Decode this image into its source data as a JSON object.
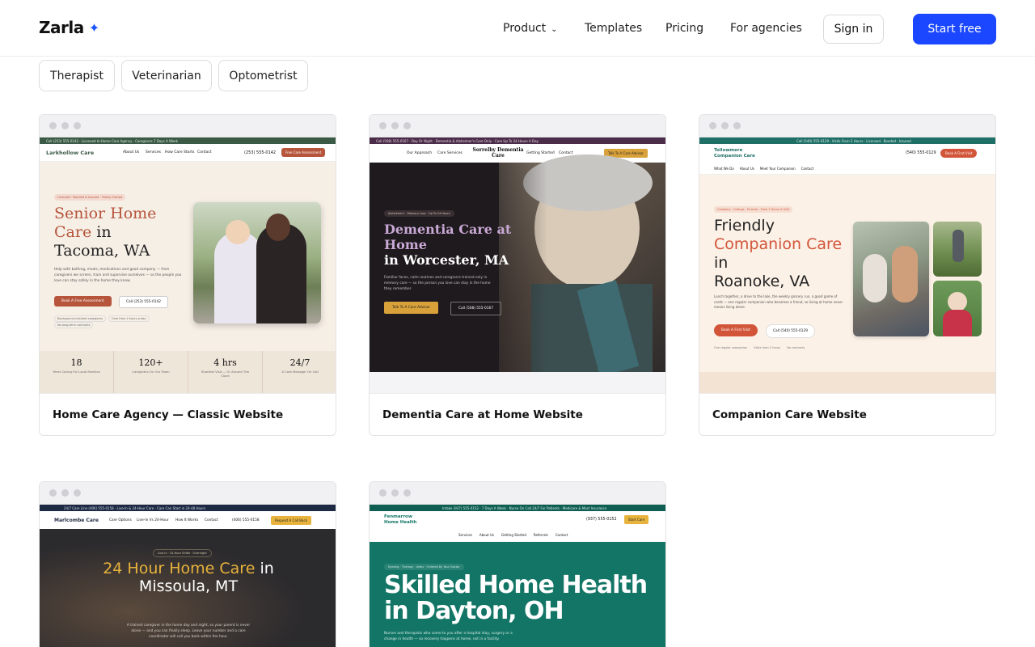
{
  "header": {
    "logo_text": "Zarla",
    "logo_mark": "✦",
    "nav": {
      "product": "Product",
      "templates": "Templates",
      "pricing": "Pricing",
      "agencies": "For agencies"
    },
    "sign_in": "Sign in",
    "start_free": "Start free"
  },
  "filters": [
    "Therapist",
    "Veterinarian",
    "Optometrist"
  ],
  "cards": [
    {
      "title": "Home Care Agency — Classic Website",
      "site": {
        "topbar": "Call (253) 555-0142 · Licensed In-Home Care Agency · Caregivers 7 Days A Week",
        "brand": "Larkhollow Care",
        "menu": [
          "About Us",
          "Services",
          "How Care Starts",
          "Contact"
        ],
        "phone": "(253) 555-0142",
        "cta": "Free Care Assessment",
        "pill": "Licensed · Bonded & Insured · Family-Owned",
        "headline_accent": "Senior Home Care",
        "headline_rest1": "in",
        "headline_rest2": "Tacoma, WA",
        "body": "Help with bathing, meals, medications and good company — from caregivers we screen, train and supervise ourselves — so the people you love can stay safely in the home they know.",
        "btn1": "Book A Free Assessment",
        "btn2": "Call (253) 555-0142",
        "tags": [
          "Background-checked caregivers",
          "Care from 4 hours a day",
          "No long-term contracts"
        ],
        "stats": [
          {
            "value": "18",
            "label": "Years Caring For Local Families"
          },
          {
            "value": "120+",
            "label": "Caregivers On Our Team"
          },
          {
            "value": "4 hrs",
            "label": "Shortest Visit — Or Around The Clock"
          },
          {
            "value": "24/7",
            "label": "A Care Manager On Call"
          }
        ]
      }
    },
    {
      "title": "Dementia Care at Home Website",
      "site": {
        "topbar": "Call (508) 555-0167 · Day Or Night · Dementia & Alzheimer's Care Only · Care Up To 24 Hours A Day",
        "menu_left": [
          "Our Approach",
          "Care Services"
        ],
        "brand": "Sorrelby Dementia Care",
        "menu_right": [
          "Getting Started",
          "Contact"
        ],
        "cta": "Talk To A Care Advisor",
        "pill": "Alzheimer's · Memory Loss · Up To 24 Hours",
        "headline_accent": "Dementia Care at Home",
        "headline_rest": "in Worcester, MA",
        "body": "Familiar faces, calm routines and caregivers trained only in memory care — so the person you love can stay in the home they remember.",
        "btn1": "Talk To A Care Advisor",
        "btn2": "Call (508) 555-0167"
      }
    },
    {
      "title": "Companion Care Website",
      "site": {
        "topbar": "Call (540) 555-0129 · Visits From 2 Hours · Licensed · Bonded · Insured",
        "brand": "Tollowmere Companion Care",
        "phone": "(540) 555-0129",
        "cta": "Book A First Visit",
        "menu": [
          "What We Do",
          "About Us",
          "Meet Your Companion",
          "Contact"
        ],
        "pill": "Company · Outings · Errands · From 2 Hours A Visit",
        "headline1": "Friendly",
        "headline_accent": "Companion Care",
        "headline_rest1": "in",
        "headline_rest2": "Roanoke, VA",
        "body": "Lunch together, a drive to the lake, the weekly grocery run, a good game of cards — one regular companion who becomes a friend, so living at home never means living alone.",
        "btn1": "Book A First Visit",
        "btn2": "Call (540) 555-0129",
        "tags": [
          "One regular companion",
          "Visits from 2 hours",
          "No contracts"
        ]
      }
    },
    {
      "title": "",
      "site": {
        "topbar": "24/7 Care Line (406) 555-0158 · Live-In & 24-Hour Care · Care Can Start in 24-48 Hours",
        "brand": "Marlcombe Care",
        "menu": [
          "Care Options",
          "Live-In Vs 24-Hour",
          "How It Works",
          "Contact"
        ],
        "phone": "(406) 555-0158",
        "cta": "Request A Call Back",
        "pill": "Live-In · 24-Hour Shifts · Overnight",
        "headline_accent": "24 Hour Home Care",
        "headline_rest1": "in",
        "headline_rest2": "Missoula, MT",
        "body": "A trained caregiver in the home day and night, so your parent is never alone — and you can finally sleep. Leave your number and a care coordinator will call you back within the hour."
      }
    },
    {
      "title": "",
      "site": {
        "topbar": "Intake (937) 555-0152 · 7 Days A Week · Nurse On Call 24/7 For Patients · Medicare & Most Insurance",
        "brand": "Fenmarrow Home Health",
        "phone": "(937) 555-0152",
        "cta": "Start Care",
        "menu": [
          "Services",
          "About Us",
          "Getting Started",
          "Referrals",
          "Contact"
        ],
        "pill": "Nursing · Therapy · Aides · Ordered By Your Doctor",
        "headline1": "Skilled Home Health",
        "headline2": "in Dayton, OH",
        "body": "Nurses and therapists who come to you after a hospital stay, surgery or a change in health — so recovery happens at home, not in a facility."
      }
    }
  ],
  "colors": {
    "accent": "#1a47ff",
    "card1_accent": "#b6553c",
    "card2_bg": "#1f1a1d",
    "card2_gold": "#d8a13a",
    "card3_accent": "#d2553a",
    "card4_gold": "#e8b33c",
    "card5_teal": "#137566"
  }
}
